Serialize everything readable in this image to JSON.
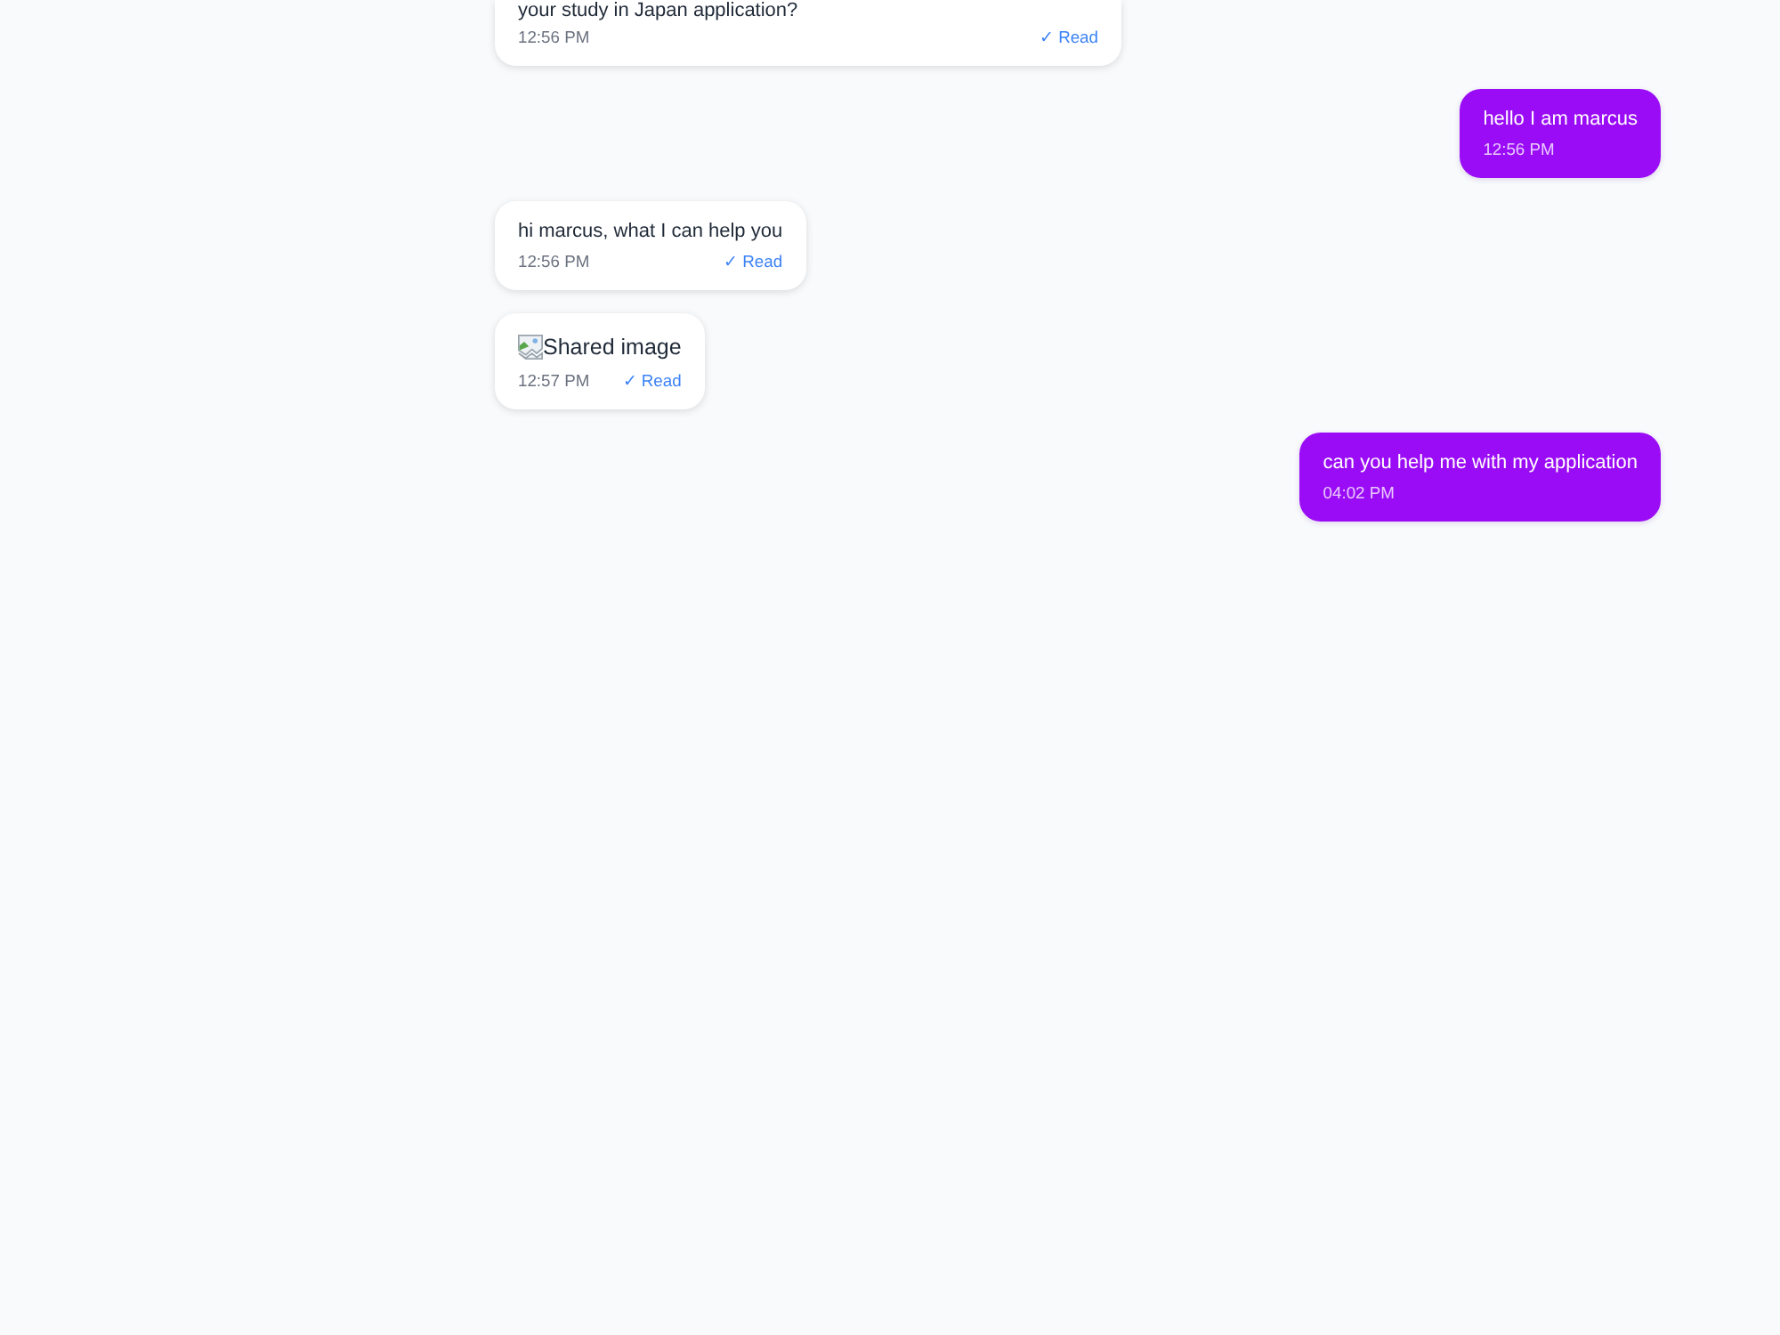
{
  "messages": [
    {
      "kind": "text",
      "outgoing": false,
      "cut_off": true,
      "text": "your study in Japan application?",
      "time": "12:56 PM",
      "status": "✓ Read"
    },
    {
      "kind": "text",
      "outgoing": true,
      "cut_off": false,
      "text": "hello I am marcus",
      "time": "12:56 PM"
    },
    {
      "kind": "text",
      "outgoing": false,
      "cut_off": false,
      "text": "hi marcus, what I can help you",
      "time": "12:56 PM",
      "status": "✓ Read"
    },
    {
      "kind": "image",
      "outgoing": false,
      "cut_off": false,
      "alt": "Shared image",
      "time": "12:57 PM",
      "status": "✓ Read"
    },
    {
      "kind": "text",
      "outgoing": true,
      "cut_off": false,
      "text": "can you help me with my application",
      "time": "04:02 PM"
    }
  ]
}
